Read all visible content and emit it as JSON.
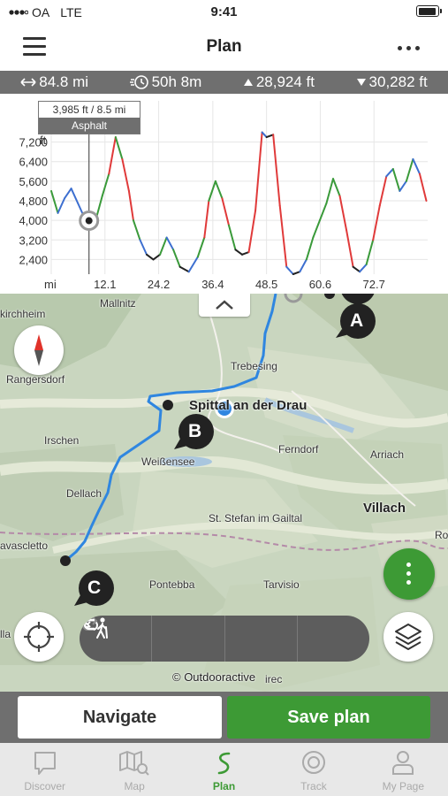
{
  "status_bar": {
    "carrier": "OA",
    "network": "LTE",
    "time": "9:41"
  },
  "header": {
    "title": "Plan"
  },
  "stats": {
    "distance": "84.8 mi",
    "duration": "50h 8m",
    "ascent": "28,924 ft",
    "descent": "30,282 ft"
  },
  "elevation": {
    "tooltip_value": "3,985 ft / 8.5 mi",
    "tooltip_surface": "Asphalt",
    "y_unit": "ft",
    "x_unit": "mi",
    "y_ticks": [
      "7,200",
      "6,400",
      "5,600",
      "4,800",
      "4,000",
      "3,200",
      "2,400"
    ],
    "x_ticks": [
      "12.1",
      "24.2",
      "36.4",
      "48.5",
      "60.6",
      "72.7"
    ]
  },
  "chart_data": {
    "type": "line",
    "xlabel": "mi",
    "ylabel": "ft",
    "ylim": [
      1800,
      7800
    ],
    "xlim": [
      0,
      84.8
    ],
    "grid": true,
    "x": [
      0,
      1.5,
      3,
      4.5,
      6,
      7.5,
      8.5,
      10,
      11.5,
      13,
      14.5,
      16,
      17.5,
      18.5,
      20,
      21.5,
      23,
      24.5,
      26,
      27.5,
      29,
      31,
      33,
      34.5,
      35.5,
      37,
      38.5,
      40,
      41.5,
      43,
      44.5,
      46,
      47.5,
      48.5,
      50,
      51.5,
      53,
      54.5,
      56,
      57.5,
      59,
      60.5,
      62,
      63.5,
      65,
      66.5,
      68,
      69.5,
      71,
      72.5,
      74,
      75.5,
      77,
      78.5,
      80,
      81.5,
      83,
      84.5
    ],
    "y": [
      5200,
      4300,
      4900,
      5300,
      4700,
      4100,
      3985,
      4000,
      5000,
      5900,
      7400,
      6500,
      5200,
      4000,
      3200,
      2600,
      2400,
      2600,
      3300,
      2800,
      2100,
      1900,
      2500,
      3300,
      4800,
      5600,
      4900,
      3800,
      2800,
      2600,
      2700,
      4400,
      7600,
      7400,
      7500,
      4600,
      2100,
      1800,
      1900,
      2400,
      3300,
      4000,
      4700,
      5700,
      5000,
      3600,
      2100,
      1900,
      2200,
      3200,
      4600,
      5800,
      6100,
      5200,
      5600,
      6500,
      5900,
      4800
    ],
    "marker": {
      "x": 8.5,
      "y": 3985
    }
  },
  "map": {
    "labels": {
      "mallnitz": "Mallnitz",
      "kirchheim": "kirchheim",
      "rangersdorf": "Rangersdorf",
      "trebesing": "Trebesing",
      "spittal": "Spittal an der Drau",
      "irschen": "Irschen",
      "weissensee": "Weißensee",
      "ferndorf": "Ferndorf",
      "arriach": "Arriach",
      "dellach": "Dellach",
      "villach": "Villach",
      "ro": "Ro",
      "st_stefan": "St. Stefan im Gailtal",
      "ravascletto": "avascletto",
      "pontebba": "Pontebba",
      "tarvisio": "Tarvisio",
      "illa": "lla",
      "zirec": "irec"
    },
    "waypoints": [
      "A",
      "B",
      "C"
    ],
    "copyright": "© Outdooractive"
  },
  "actions": {
    "navigate": "Navigate",
    "save": "Save plan"
  },
  "tabs": [
    {
      "label": "Discover",
      "icon": "chat-bubble-icon"
    },
    {
      "label": "Map",
      "icon": "map-icon"
    },
    {
      "label": "Plan",
      "icon": "route-icon"
    },
    {
      "label": "Track",
      "icon": "record-icon"
    },
    {
      "label": "My Page",
      "icon": "person-icon"
    }
  ],
  "colors": {
    "brand_green": "#3d9a35",
    "route_blue": "#2f86e0",
    "bar_gray": "#6f6f6f"
  }
}
